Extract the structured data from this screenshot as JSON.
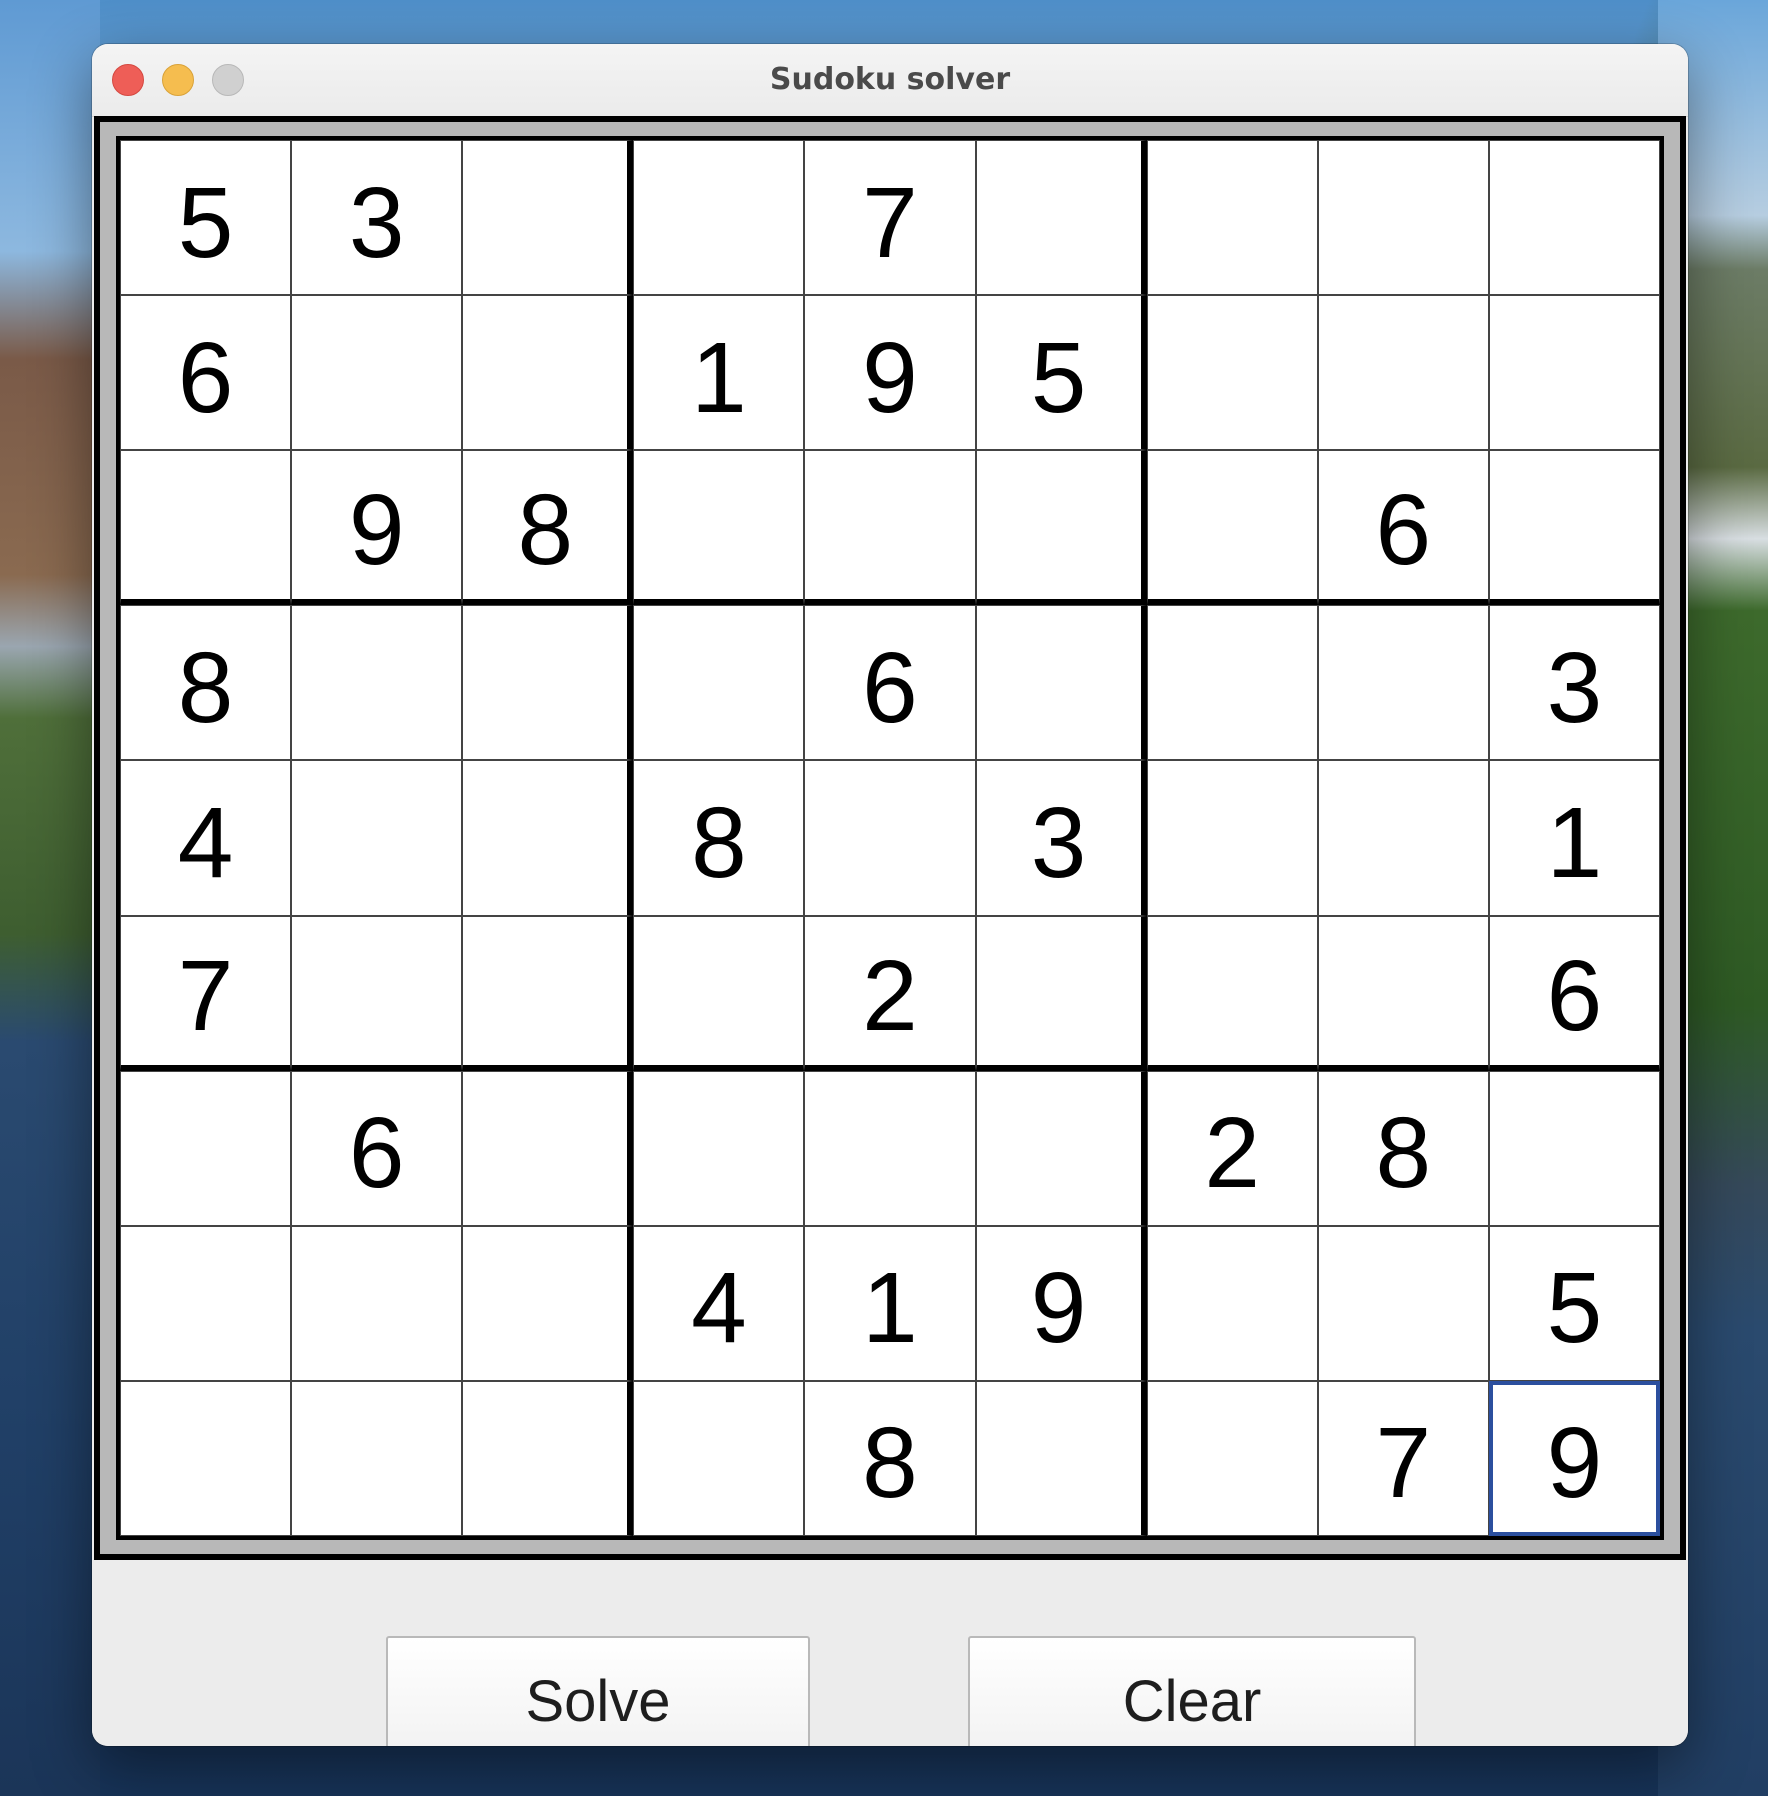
{
  "window": {
    "title": "Sudoku solver"
  },
  "board": {
    "rows": [
      [
        "5",
        "3",
        "",
        "",
        "7",
        "",
        "",
        "",
        ""
      ],
      [
        "6",
        "",
        "",
        "1",
        "9",
        "5",
        "",
        "",
        ""
      ],
      [
        "",
        "9",
        "8",
        "",
        "",
        "",
        "",
        "6",
        ""
      ],
      [
        "8",
        "",
        "",
        "",
        "6",
        "",
        "",
        "",
        "3"
      ],
      [
        "4",
        "",
        "",
        "8",
        "",
        "3",
        "",
        "",
        "1"
      ],
      [
        "7",
        "",
        "",
        "",
        "2",
        "",
        "",
        "",
        "6"
      ],
      [
        "",
        "6",
        "",
        "",
        "",
        "",
        "2",
        "8",
        ""
      ],
      [
        "",
        "",
        "",
        "4",
        "1",
        "9",
        "",
        "",
        "5"
      ],
      [
        "",
        "",
        "",
        "",
        "8",
        "",
        "",
        "7",
        "9"
      ]
    ],
    "selected_cell": {
      "row": 8,
      "col": 8
    }
  },
  "buttons": {
    "solve_label": "Solve",
    "clear_label": "Clear"
  },
  "colors": {
    "selection": "#2b4f9e",
    "close": "#ee5e57",
    "minimize": "#f5bd4f",
    "maximize": "#d0d0d0"
  }
}
